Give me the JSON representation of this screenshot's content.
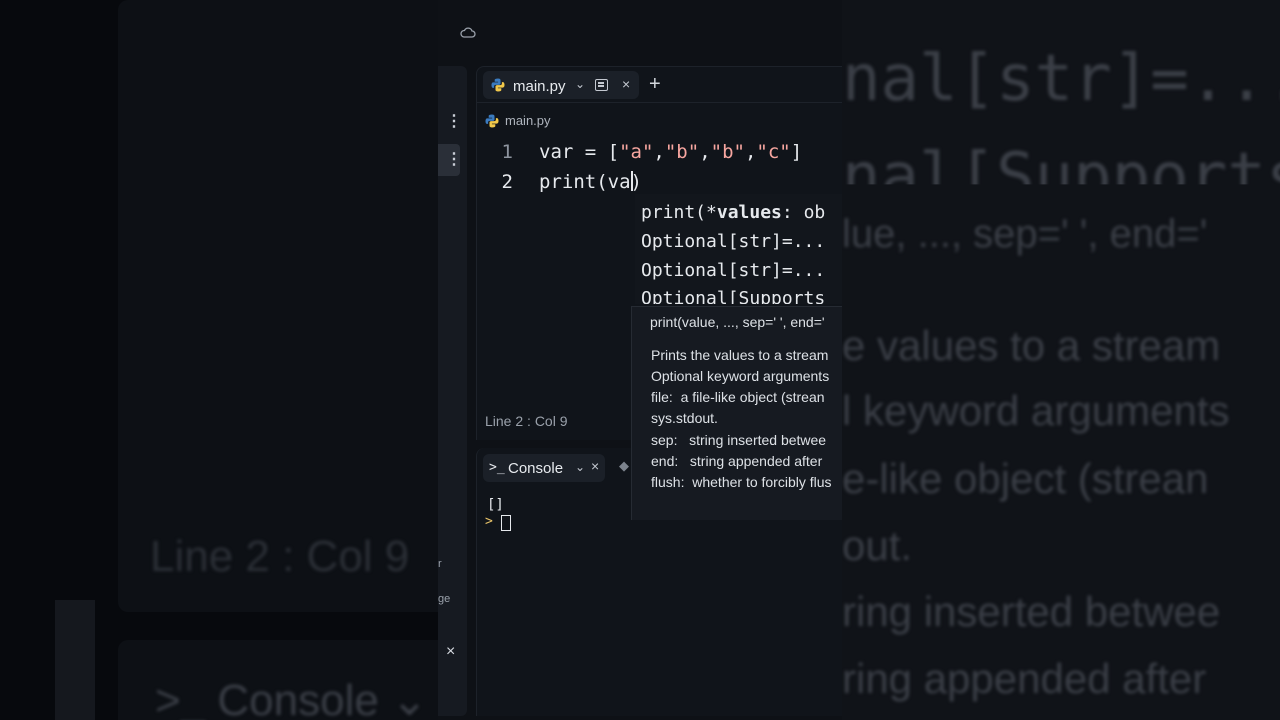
{
  "editor": {
    "tab_label": "main.py",
    "tab_chevron": "⌄",
    "tab_close": "×",
    "new_tab": "+",
    "breadcrumb": "main.py",
    "line_numbers": [
      "1",
      "2"
    ],
    "line1": {
      "prefix": "var = [",
      "s1": "\"a\"",
      "c1": ",",
      "s2": "\"b\"",
      "c2": ",",
      "s3": "\"b\"",
      "c3": ",",
      "s4": "\"c\"",
      "suffix": "]"
    },
    "line2": {
      "before_caret": "print(va",
      "after_caret": ")"
    },
    "status": "Line 2 : Col 9"
  },
  "signature_help": {
    "line1_prefix": "print(*",
    "line1_bold": "values",
    "line1_suffix": ": ob",
    "line2": "Optional[str]=...",
    "line3": "Optional[str]=...",
    "line4": "Optional[Supports"
  },
  "doc_popup": {
    "signature": "print(value, ..., sep=' ', end='",
    "lines": [
      "Prints the values to a stream",
      "Optional keyword arguments",
      "file:  a file-like object (strean",
      "sys.stdout.",
      "sep:   string inserted betwee",
      "end:   string appended after",
      "flush:  whether to forcibly flus"
    ]
  },
  "console": {
    "tab_label": "Console",
    "tab_icon": ">_",
    "chevron": "⌄",
    "close": "×",
    "output": "[]",
    "prompt": ">"
  },
  "sidebar": {
    "more_icon": "⋮",
    "close": "×",
    "partial_labels": [
      "r",
      "ge"
    ]
  },
  "background": {
    "left_status": "Line 2 : Col 9",
    "left_console": ">_ Console ⌄",
    "right_lines": [
      "nal[str]=...",
      "nal[Supports",
      "lue, ..., sep=' ', end='",
      "e values to a stream",
      "l keyword arguments",
      "e-like object (strean",
      "out.",
      "ring inserted betwee",
      "ring appended after"
    ]
  },
  "colors": {
    "string": "#f7a6a0",
    "prompt": "#e9c46a",
    "python_blue": "#3b7bbf",
    "python_yellow": "#f1c84b"
  }
}
